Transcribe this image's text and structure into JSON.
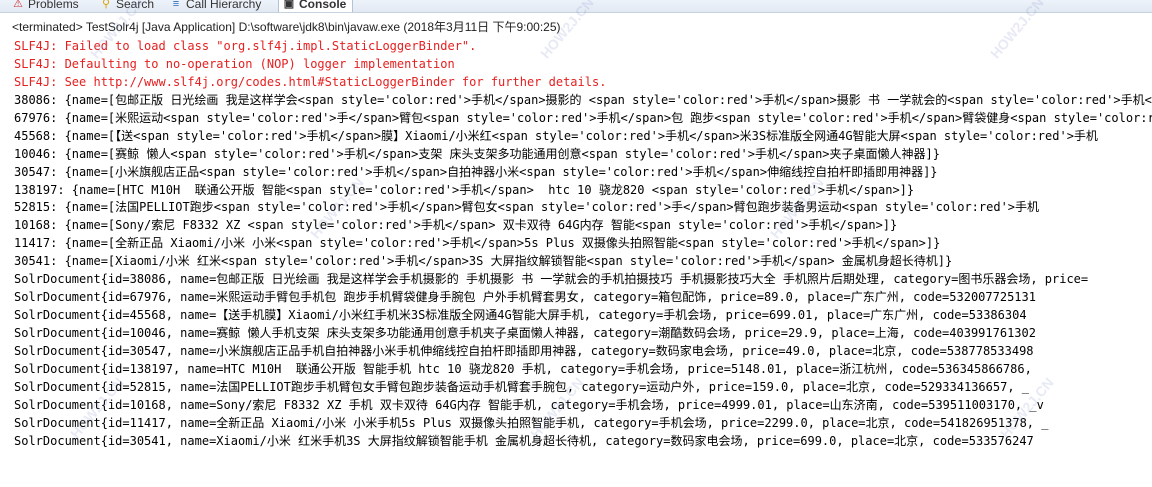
{
  "tabs": [
    {
      "label": "Problems",
      "icon": "problems-icon"
    },
    {
      "label": "Search",
      "icon": "search-icon"
    },
    {
      "label": "Call Hierarchy",
      "icon": "call-hierarchy-icon"
    },
    {
      "label": "Console",
      "icon": "console-icon",
      "active": true
    }
  ],
  "status": "<terminated> TestSolr4j [Java Application] D:\\software\\jdk8\\bin\\javaw.exe (2018年3月11日 下午9:00:25)",
  "console_lines": [
    {
      "text": "SLF4J: Failed to load class \"org.slf4j.impl.StaticLoggerBinder\".",
      "error": true
    },
    {
      "text": "SLF4J: Defaulting to no-operation (NOP) logger implementation",
      "error": true
    },
    {
      "text": "SLF4J: See http://www.slf4j.org/codes.html#StaticLoggerBinder for further details.",
      "error": true
    },
    {
      "text": "38086: {name=[包邮正版 日光绘画 我是这样学会<span style='color:red'>手机</span>摄影的 <span style='color:red'>手机</span>摄影 书 一学就会的<span style='color:red'>手机</span>",
      "error": false
    },
    {
      "text": "67976: {name=[米熙运动<span style='color:red'>手</span>臂包<span style='color:red'>手机</span>包 跑步<span style='color:red'>手机</span>臂袋健身<span style='color:red'>手",
      "error": false
    },
    {
      "text": "45568: {name=[【送<span style='color:red'>手机</span>膜】Xiaomi/小米红<span style='color:red'>手机</span>米3S标准版全网通4G智能大屏<span style='color:red'>手机",
      "error": false
    },
    {
      "text": "10046: {name=[赛鲸 懒人<span style='color:red'>手机</span>支架 床头支架多功能通用创意<span style='color:red'>手机</span>夹子桌面懒人神器]}",
      "error": false
    },
    {
      "text": "30547: {name=[小米旗舰店正品<span style='color:red'>手机</span>自拍神器小米<span style='color:red'>手机</span>伸缩线控自拍杆即插即用神器]}",
      "error": false
    },
    {
      "text": "138197: {name=[HTC M10H  联通公开版 智能<span style='color:red'>手机</span>  htc 10 骁龙820 <span style='color:red'>手机</span>]}",
      "error": false
    },
    {
      "text": "52815: {name=[法国PELLIOT跑步<span style='color:red'>手机</span>臂包女<span style='color:red'>手</span>臂包跑步装备男运动<span style='color:red'>手机",
      "error": false
    },
    {
      "text": "10168: {name=[Sony/索尼 F8332 XZ <span style='color:red'>手机</span> 双卡双待 64G内存 智能<span style='color:red'>手机</span>]}",
      "error": false
    },
    {
      "text": "11417: {name=[全新正品 Xiaomi/小米 小米<span style='color:red'>手机</span>5s Plus 双摄像头拍照智能<span style='color:red'>手机</span>]}",
      "error": false
    },
    {
      "text": "30541: {name=[Xiaomi/小米 红米<span style='color:red'>手机</span>3S 大屏指纹解锁智能<span style='color:red'>手机</span> 金属机身超长待机]}",
      "error": false
    },
    {
      "text": "SolrDocument{id=38086, name=包邮正版 日光绘画 我是这样学会手机摄影的 手机摄影 书 一学就会的手机拍摄技巧 手机摄影技巧大全 手机照片后期处理, category=图书乐器会场, price=",
      "error": false
    },
    {
      "text": "SolrDocument{id=67976, name=米熙运动手臂包手机包 跑步手机臂袋健身手腕包 户外手机臂套男女, category=箱包配饰, price=89.0, place=广东广州, code=532007725131",
      "error": false
    },
    {
      "text": "SolrDocument{id=45568, name=【送手机膜】Xiaomi/小米红手机米3S标准版全网通4G智能大屏手机, category=手机会场, price=699.01, place=广东广州, code=53386304",
      "error": false
    },
    {
      "text": "SolrDocument{id=10046, name=赛鲸 懒人手机支架 床头支架多功能通用创意手机夹子桌面懒人神器, category=潮酷数码会场, price=29.9, place=上海, code=403991761302",
      "error": false
    },
    {
      "text": "SolrDocument{id=30547, name=小米旗舰店正品手机自拍神器小米手机伸缩线控自拍杆即插即用神器, category=数码家电会场, price=49.0, place=北京, code=538778533498",
      "error": false
    },
    {
      "text": "SolrDocument{id=138197, name=HTC M10H  联通公开版 智能手机 htc 10 骁龙820 手机, category=手机会场, price=5148.01, place=浙江杭州, code=536345866786,",
      "error": false
    },
    {
      "text": "SolrDocument{id=52815, name=法国PELLIOT跑步手机臂包女手臂包跑步装备运动手机臂套手腕包, category=运动户外, price=159.0, place=北京, code=529334136657, _",
      "error": false
    },
    {
      "text": "SolrDocument{id=10168, name=Sony/索尼 F8332 XZ 手机 双卡双待 64G内存 智能手机, category=手机会场, price=4999.01, place=山东济南, code=539511003170, _v",
      "error": false
    },
    {
      "text": "SolrDocument{id=11417, name=全新正品 Xiaomi/小米 小米手机5s Plus 双摄像头拍照智能手机, category=手机会场, price=2299.0, place=北京, code=541826951378, _",
      "error": false
    },
    {
      "text": "SolrDocument{id=30541, name=Xiaomi/小米 红米手机3S 大屏指纹解锁智能手机 金属机身超长待机, category=数码家电会场, price=699.0, place=北京, code=533576247",
      "error": false
    }
  ],
  "watermark": "HOW2J.CN"
}
